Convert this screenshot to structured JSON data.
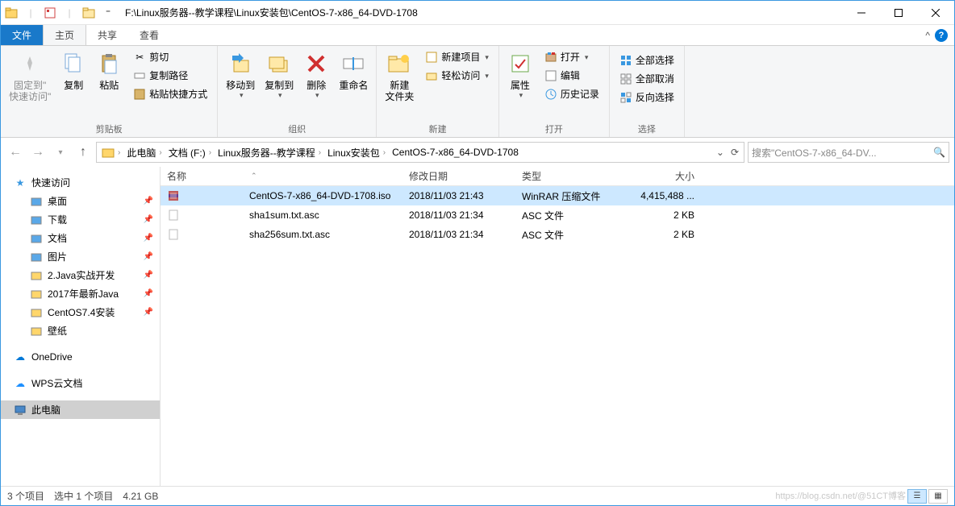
{
  "title": "F:\\Linux服务器--教学课程\\Linux安装包\\CentOS-7-x86_64-DVD-1708",
  "tabs": {
    "file": "文件",
    "home": "主页",
    "share": "共享",
    "view": "查看"
  },
  "ribbon": {
    "clipboard": {
      "pin": "固定到\"\n快速访问\"",
      "copy": "复制",
      "paste": "粘贴",
      "cut": "剪切",
      "copy_path": "复制路径",
      "paste_shortcut": "粘贴快捷方式",
      "label": "剪贴板"
    },
    "organize": {
      "move_to": "移动到",
      "copy_to": "复制到",
      "delete": "删除",
      "rename": "重命名",
      "label": "组织"
    },
    "new": {
      "new_folder": "新建\n文件夹",
      "new_item": "新建项目",
      "easy_access": "轻松访问",
      "label": "新建"
    },
    "open": {
      "properties": "属性",
      "open": "打开",
      "edit": "编辑",
      "history": "历史记录",
      "label": "打开"
    },
    "select": {
      "select_all": "全部选择",
      "select_none": "全部取消",
      "invert": "反向选择",
      "label": "选择"
    }
  },
  "breadcrumb": {
    "segs": [
      "此电脑",
      "文档 (F:)",
      "Linux服务器--教学课程",
      "Linux安装包",
      "CentOS-7-x86_64-DVD-1708"
    ]
  },
  "search_placeholder": "搜索\"CentOS-7-x86_64-DV...",
  "sidebar": {
    "quick_access": "快速访问",
    "items": [
      {
        "label": "桌面",
        "pin": true
      },
      {
        "label": "下载",
        "pin": true
      },
      {
        "label": "文档",
        "pin": true
      },
      {
        "label": "图片",
        "pin": true
      },
      {
        "label": "2.Java实战开发",
        "pin": true
      },
      {
        "label": "2017年最新Java",
        "pin": true
      },
      {
        "label": "CentOS7.4安装",
        "pin": true
      },
      {
        "label": "壁纸",
        "pin": false
      }
    ],
    "onedrive": "OneDrive",
    "wps": "WPS云文档",
    "this_pc": "此电脑"
  },
  "columns": {
    "name": "名称",
    "date": "修改日期",
    "type": "类型",
    "size": "大小"
  },
  "files": [
    {
      "name": "CentOS-7-x86_64-DVD-1708.iso",
      "date": "2018/11/03 21:43",
      "type": "WinRAR 压缩文件",
      "size": "4,415,488 ...",
      "sel": true,
      "icon": "rar"
    },
    {
      "name": "sha1sum.txt.asc",
      "date": "2018/11/03 21:34",
      "type": "ASC 文件",
      "size": "2 KB",
      "sel": false,
      "icon": "txt"
    },
    {
      "name": "sha256sum.txt.asc",
      "date": "2018/11/03 21:34",
      "type": "ASC 文件",
      "size": "2 KB",
      "sel": false,
      "icon": "txt"
    }
  ],
  "status": {
    "count": "3 个项目",
    "selected": "选中 1 个项目",
    "size": "4.21 GB"
  },
  "watermark": "https://blog.csdn.net/@51CT博客"
}
